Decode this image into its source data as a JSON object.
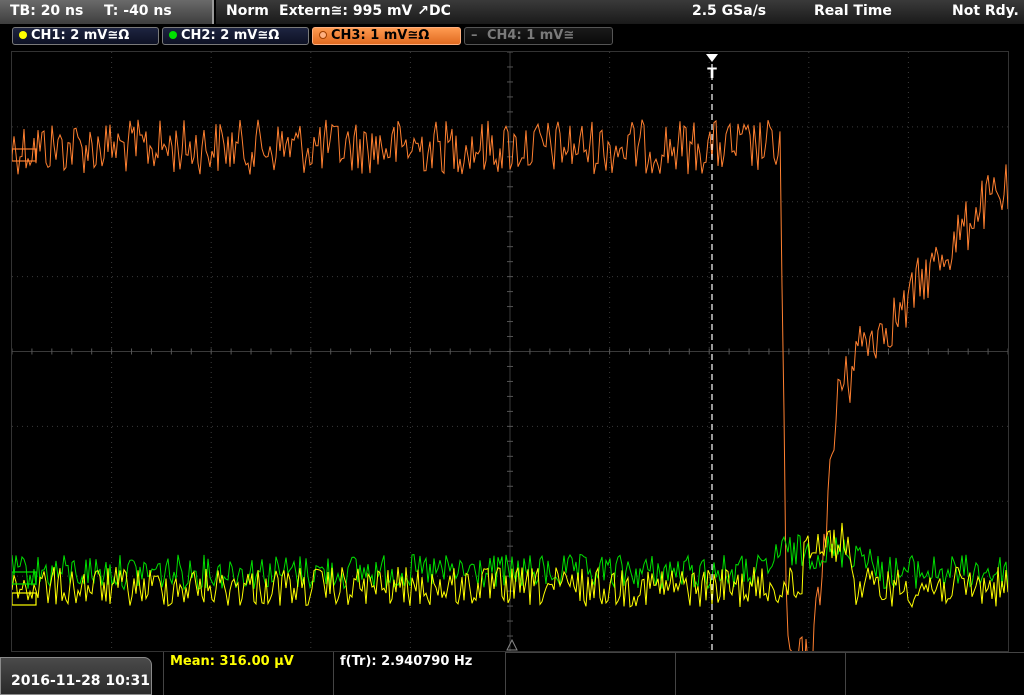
{
  "header": {
    "timebase": "TB: 20 ns",
    "trigger_time": "T: -40 ns",
    "mode": "Norm",
    "trigger_source": "Extern≅: 995 mV ↗DC",
    "sample_rate": "2.5 GSa/s",
    "acq_mode": "Real Time",
    "status": "Not Rdy."
  },
  "channels": [
    {
      "label": "CH1: 2 mV≅Ω",
      "color": "#ffff00",
      "active": true
    },
    {
      "label": "CH2: 2 mV≅Ω",
      "color": "#00e000",
      "active": true
    },
    {
      "label": "CH3: 1 mV≅Ω",
      "color": "#ff8030",
      "active": true
    },
    {
      "label": "CH4: 1 mV≅",
      "color": "#7a7a7a",
      "active": false
    }
  ],
  "trigger_marker": "T",
  "footer": {
    "datetime": "2016-11-28 10:31",
    "mean": "Mean: 316.00 µV",
    "frequency": "f(Tr): 2.940790 Hz"
  },
  "colors": {
    "ch1": "#ffff00",
    "ch2": "#00e000",
    "ch3": "#ff8030",
    "grid": "#3a3a3a",
    "trigger_line": "#ffffff"
  }
}
